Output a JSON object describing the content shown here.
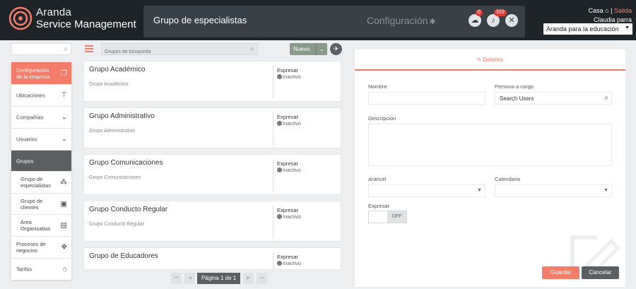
{
  "header": {
    "brand_line1": "Aranda",
    "brand_line2": "Service Management",
    "page_title": "Grupo de especialistas",
    "config_label": "Configuración",
    "notif_cloud_count": "0",
    "notif_bell_count": "310",
    "casa_label": "Casa",
    "salida_label": "Salida",
    "user_name": "Claudia parra",
    "org_selected": "Aranda para la educación"
  },
  "sidebar": {
    "items": [
      {
        "label": "Configuración de la empresa",
        "icon": "copy-icon"
      },
      {
        "label": "Ubicaciones",
        "icon": "signpost-icon"
      },
      {
        "label": "Compañías",
        "icon": "chevron-down-icon"
      },
      {
        "label": "Usuarios",
        "icon": "chevron-down-icon"
      },
      {
        "label": "Grupos",
        "icon": ""
      },
      {
        "label": "Grupo de especialistas",
        "icon": "group-icon"
      },
      {
        "label": "Grupo de clientes",
        "icon": "contacts-icon"
      },
      {
        "label": "Área Organizativa",
        "icon": "org-area-icon"
      },
      {
        "label": "Procesos de negocios",
        "icon": "move-icon"
      },
      {
        "label": "Tarifas",
        "icon": "bank-icon"
      }
    ]
  },
  "list": {
    "search_placeholder": "Grupos de búsqueda",
    "new_label": "Nuevo",
    "groups": [
      {
        "title": "Grupo Académico",
        "subtitle": "Grupo Académico",
        "express": "Expresar",
        "status": "Inactivo"
      },
      {
        "title": "Grupo Administrativo",
        "subtitle": "Grupo Administrativo",
        "express": "Expresar",
        "status": "Inactivo"
      },
      {
        "title": "Grupo Comunicaciones",
        "subtitle": "Grupo Comunicaciones",
        "express": "Expresar",
        "status": "Inactivo"
      },
      {
        "title": "Grupo Conducto Regular",
        "subtitle": "Grupo Conducto Regular",
        "express": "Expresar",
        "status": "Inactivo"
      },
      {
        "title": "Grupo de Educadores",
        "subtitle": "",
        "express": "Expresar",
        "status": "Inactivo"
      }
    ],
    "pager_text": "Página 1 de 1"
  },
  "details": {
    "tab_label": "Detalles",
    "name_label": "Nombre",
    "name_value": "",
    "person_label": "Persona a cargo",
    "person_placeholder": "Search Users",
    "description_label": "Descripción",
    "arancel_label": "Arancel",
    "calendario_label": "Calendario",
    "expresar_label": "Expresar",
    "toggle_off": "OFF",
    "save_label": "Guardar",
    "cancel_label": "Cancelar"
  },
  "colors": {
    "accent": "#f47c6a",
    "topbar": "#1f2428",
    "dark_button": "#5b5f62"
  }
}
